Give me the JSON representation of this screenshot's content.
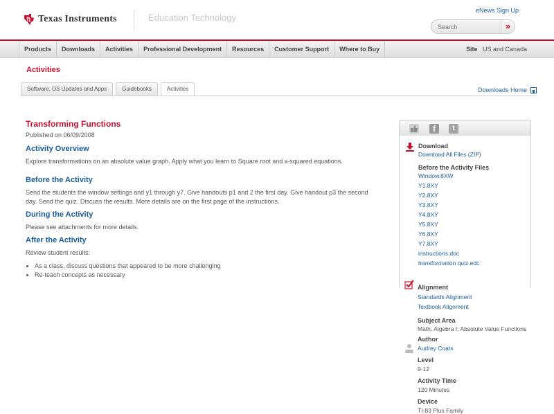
{
  "header": {
    "brand": "Texas Instruments",
    "tagline": "Education Technology",
    "enews": "eNews Sign Up",
    "search_placeholder": "Search",
    "search_button": "»"
  },
  "nav": {
    "items": [
      "Products",
      "Downloads",
      "Activities",
      "Professional Development",
      "Resources",
      "Customer Support",
      "Where to Buy"
    ],
    "site_label": "Site",
    "site_value": "US and Canada"
  },
  "section_title": "Activities",
  "tabs": [
    "Software, OS Updates and Apps",
    "Guidebooks",
    "Activities"
  ],
  "downloads_home": "Downloads Home",
  "activity": {
    "title": "Transforming Functions",
    "published": "Published on 06/09/2008",
    "overview_heading": "Activity Overview",
    "overview_text": "Explore transformations on an absolute value graph. Apply what you learn to Square root and x-squared equations.",
    "before_heading": "Before the Activity",
    "before_text": "Send the students the window settings and y1 through y7. Give handouts p1 and 2 the first day. Give handout p3 the second day. Send the quiz. Discuss the results. More details are on the first page of the instructions.",
    "during_heading": "During the Activity",
    "during_text": "Please see attachments for more details.",
    "after_heading": "After the Activity",
    "after_text": "Review student results:",
    "after_bullets": [
      "As a class, discuss questions that appeared to be more challenging",
      "Re-teach concepts as necessary"
    ]
  },
  "sidebar": {
    "download_heading": "Download",
    "download_all": "Download All Files (ZIP)",
    "before_files_heading": "Before the Activity Files",
    "files": [
      "Window.8XW",
      "Y1.8XY",
      "Y2.8XY",
      "Y3.8XY",
      "Y4.8XY",
      "Y5.8XY",
      "Y6.8XY",
      "Y7.8XY",
      "instructions.doc",
      "transformation quiz.edc"
    ],
    "alignment_heading": "Alignment",
    "standards_alignment": "Standards Alignment",
    "textbook_alignment": "Textbook Alignment",
    "subject_heading": "Subject Area",
    "subject_value": "Math: Algebra I: Absolute Value Functions",
    "author_heading": "Author",
    "author_value": "Audrey Coats",
    "level_heading": "Level",
    "level_value": "9-12",
    "time_heading": "Activity Time",
    "time_value": "120 Minutes",
    "device_heading": "Device",
    "device_value": "TI-83 Plus Family"
  }
}
